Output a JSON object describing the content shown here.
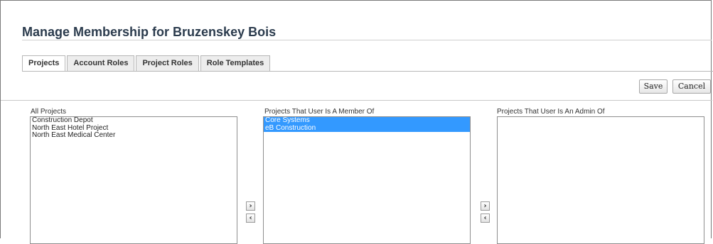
{
  "page": {
    "title": "Manage Membership for Bruzenskey Bois"
  },
  "tabs": [
    {
      "label": "Projects",
      "active": true
    },
    {
      "label": "Account Roles",
      "active": false
    },
    {
      "label": "Project Roles",
      "active": false
    },
    {
      "label": "Role Templates",
      "active": false
    }
  ],
  "toolbar": {
    "save_label": "Save",
    "cancel_label": "Cancel"
  },
  "lists": {
    "all_projects": {
      "label": "All Projects",
      "items": [
        "Construction Depot",
        "North East Hotel Project",
        "North East Medical Center"
      ]
    },
    "member_of": {
      "label": "Projects That User Is A Member Of",
      "items": [
        "Core Systems",
        "eB Construction"
      ],
      "selected": [
        "Core Systems",
        "eB Construction"
      ]
    },
    "admin_of": {
      "label": "Projects That User Is An Admin Of",
      "items": []
    }
  },
  "transfer_buttons": {
    "move_right_icon": "chevron-right-icon",
    "move_left_icon": "chevron-left-icon",
    "right_glyph": "›",
    "left_glyph": "‹"
  },
  "colors": {
    "title": "#2b3b4d",
    "selection": "#3399ff"
  }
}
